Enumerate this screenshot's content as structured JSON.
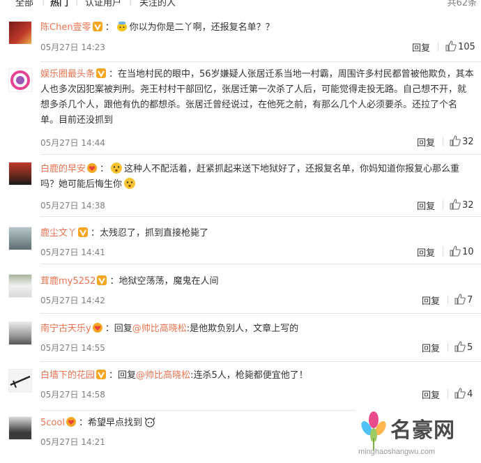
{
  "tabs": [
    "全部",
    "热门",
    "认证用户",
    "关注的人"
  ],
  "total": "共62条",
  "actions": {
    "reply": "回复"
  },
  "comments": [
    {
      "user": "陈Chen壹零",
      "badge": "vip",
      "text": "你以为你是二丫啊，还报复名单？？",
      "time": "05月27日 14:23",
      "likes": "105"
    },
    {
      "user": "娱乐圈最头条",
      "badge": "vip",
      "text": "在当地村民的眼中，56岁嫌疑人张居迁系当地一村霸，周围许多村民都曾被他欺负，其本人也多次因犯案被判刑。尧王村村干部回忆，张居迁第一次杀了人后，可能觉得走投无路。自己想不开，就想多杀几个人，跟他有仇的都想杀。张居迁曾经说过，在他死之前，有那么几个人必须要杀。还拉了个名单。目前还没抓到",
      "time": "05月27日 14:44",
      "likes": "32"
    },
    {
      "user": "白鹿的早安",
      "badge": "heart",
      "text_a": "这种人不配活着，赶紧抓起来送下地狱好了，还报复名单，你妈知道你报复心那么重吗？她可能后悔生你",
      "time": "05月27日 14:38",
      "likes": "32"
    },
    {
      "user": "鹿尘文丫",
      "badge": "vip",
      "text": "太残忍了，抓到直接枪毙了",
      "time": "05月27日 14:41",
      "likes": "10"
    },
    {
      "user": "茸鹿my5252",
      "badge": "vip",
      "text": "地狱空荡荡，魔鬼在人间",
      "time": "05月27日 14:42",
      "likes": "7"
    },
    {
      "user": "南宁古天乐y",
      "badge": "heart",
      "prefix": "回复",
      "mention": "@帅比高晓松",
      "text": ":是他欺负别人，文章上写的",
      "time": "05月27日 14:55",
      "likes": "5"
    },
    {
      "user": "白墙下的花园",
      "badge": "vip",
      "prefix": "回复",
      "mention": "@帅比高晓松",
      "text": ":连杀5人，枪毙都便宜他了！",
      "time": "05月27日 14:58",
      "likes": "4"
    },
    {
      "user": "5cool",
      "badge": "heart",
      "text": "希望早点找到",
      "time": "05月27日 14:21",
      "likes": ""
    }
  ],
  "watermark": {
    "title": "名豪网",
    "url": "minghaoshangwu.com"
  },
  "colors": {
    "username": "#eb7350",
    "vip_badge": "#f5a623",
    "heart_badge": "#e8403a",
    "divider": "#e6e6e6",
    "meta": "#808080"
  },
  "icons": [
    "vip-badge-icon",
    "heart-badge-icon",
    "emoji-icon",
    "thumbs-up-icon"
  ]
}
